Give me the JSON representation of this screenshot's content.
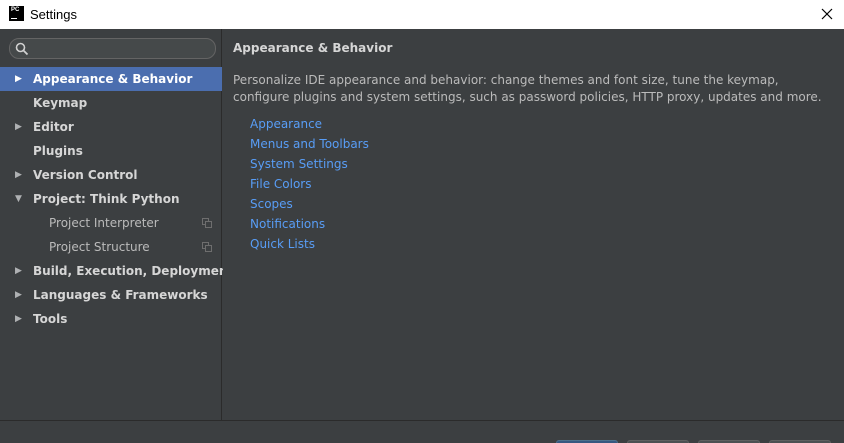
{
  "window": {
    "app_icon_text": "PC",
    "title": "Settings"
  },
  "search": {
    "value": "",
    "placeholder": ""
  },
  "sidebar": {
    "items": [
      {
        "label": "Appearance & Behavior",
        "arrow": "▶",
        "selected": true
      },
      {
        "label": "Keymap",
        "arrow": ""
      },
      {
        "label": "Editor",
        "arrow": "▶"
      },
      {
        "label": "Plugins",
        "arrow": ""
      },
      {
        "label": "Version Control",
        "arrow": "▶"
      },
      {
        "label": "Project: Think Python",
        "arrow": "▼"
      },
      {
        "label": "Project Interpreter",
        "child": true
      },
      {
        "label": "Project Structure",
        "child": true
      },
      {
        "label": "Build, Execution, Deployment",
        "arrow": "▶"
      },
      {
        "label": "Languages & Frameworks",
        "arrow": "▶"
      },
      {
        "label": "Tools",
        "arrow": "▶"
      }
    ]
  },
  "main": {
    "heading": "Appearance & Behavior",
    "description": "Personalize IDE appearance and behavior: change themes and font size, tune the keymap, configure plugins and system settings, such as password policies, HTTP proxy, updates and more.",
    "links": [
      "Appearance",
      "Menus and Toolbars",
      "System Settings",
      "File Colors",
      "Scopes",
      "Notifications",
      "Quick Lists"
    ]
  },
  "colors": {
    "background": "#3c3f41",
    "selection": "#4b6eaf",
    "link": "#589df6",
    "text": "#bbbbbb"
  },
  "icons": [
    "search-icon",
    "close-icon",
    "copy-icon",
    "expand-arrow-icon",
    "collapse-arrow-icon"
  ]
}
